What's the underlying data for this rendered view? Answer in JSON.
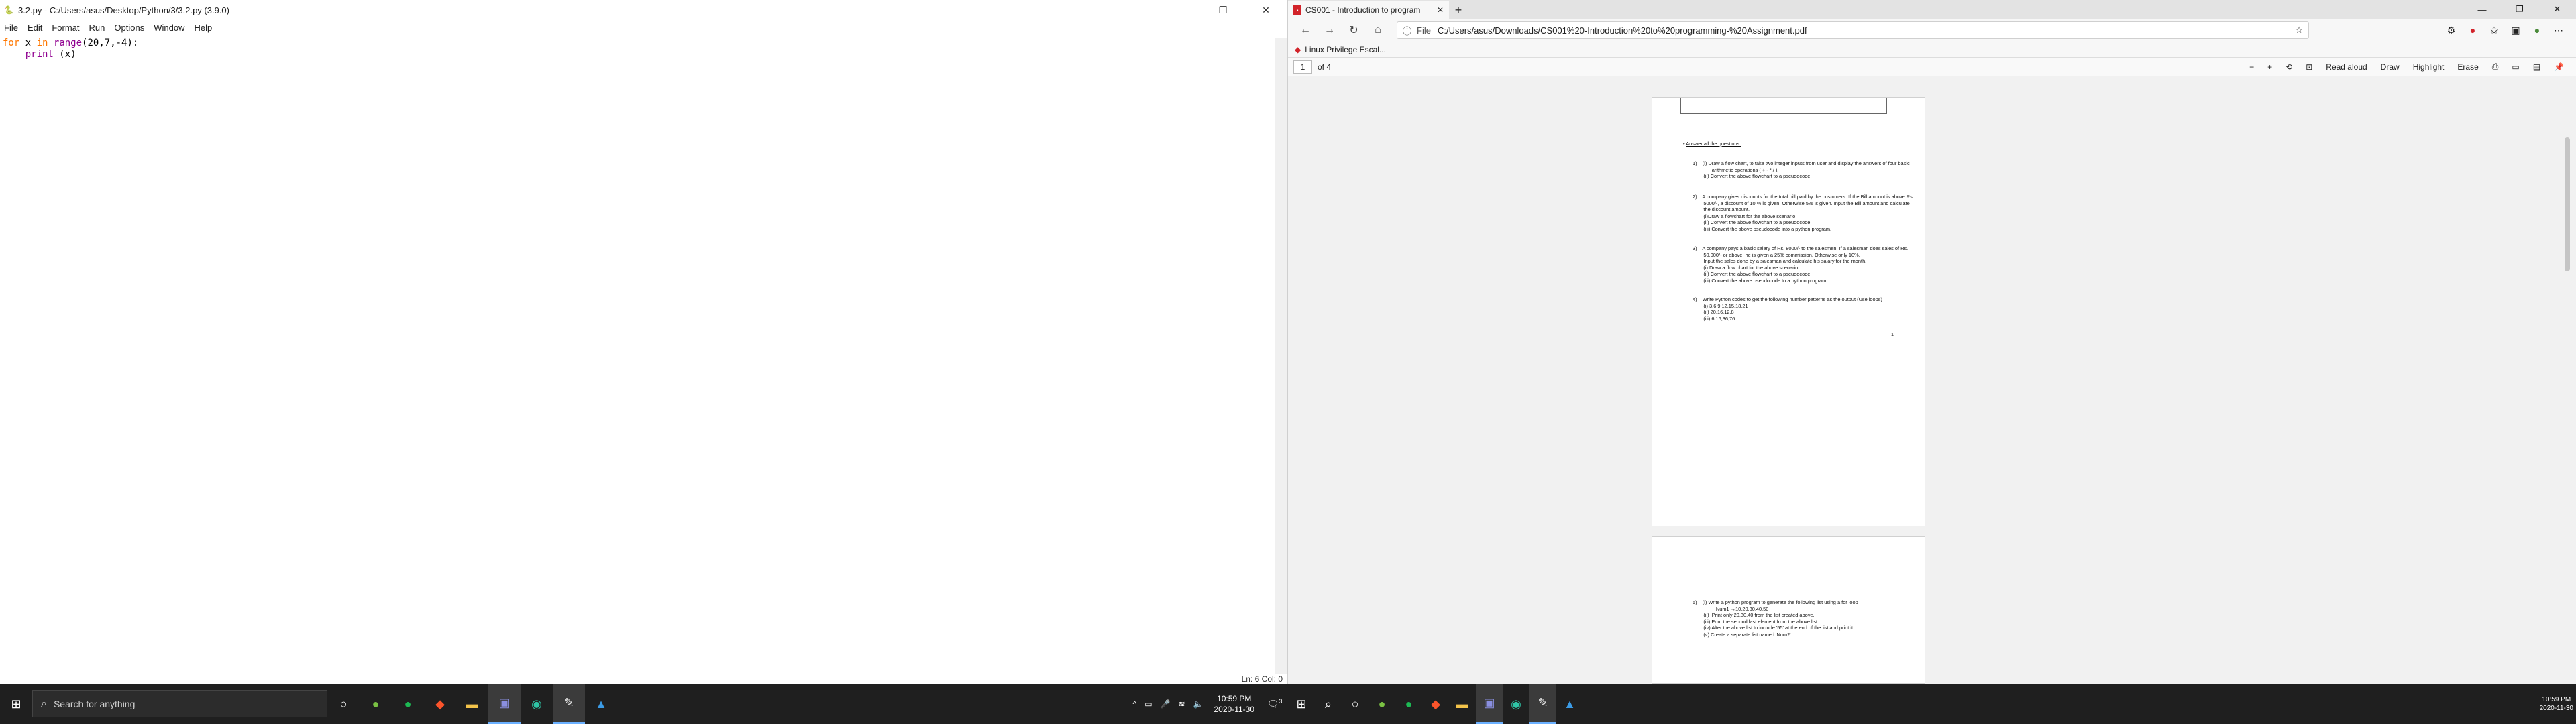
{
  "idle": {
    "title": "3.2.py - C:/Users/asus/Desktop/Python/3/3.2.py (3.9.0)",
    "menu": [
      "File",
      "Edit",
      "Format",
      "Run",
      "Options",
      "Window",
      "Help"
    ],
    "code": {
      "line1_kw1": "for",
      "line1_var": " x ",
      "line1_kw2": "in",
      "line1_sp": " ",
      "line1_builtin": "range",
      "line1_args": "(20,7,-4):",
      "line2_indent": "    ",
      "line2_builtin": "print",
      "line2_args": " (x)"
    },
    "status": "Ln: 6   Col: 0",
    "win_min": "—",
    "win_max": "❐",
    "win_close": "✕"
  },
  "browser": {
    "tab_title": "CS001 - Introduction to program",
    "tab_close": "✕",
    "new_tab": "+",
    "win_min": "—",
    "win_max": "❐",
    "win_close": "✕",
    "address_prefix": "File",
    "address": "C:/Users/asus/Downloads/CS001%20-Introduction%20to%20programming-%20Assignment.pdf",
    "bookmark": "Linux Privilege Escal...",
    "page_current": "1",
    "page_of": "of 4",
    "tools": {
      "zoom_out": "−",
      "zoom_in": "+",
      "read_aloud": "Read aloud",
      "draw": "Draw",
      "highlight": "Highlight",
      "erase": "Erase"
    }
  },
  "pdf": {
    "heading": "Answer all the questions.",
    "q1": [
      "1)    (i) Draw a flow chart, to take two integer inputs from user and display the answers of four basic",
      "              arithmetic operations ( + - * / ).",
      "        (ii) Convert the above flowchart to a pseudocode."
    ],
    "q2": [
      "2)    A company gives discounts for the total bill paid by the customers. If the Bill amount is above Rs.",
      "        5000/-, a discount of 10 % is given. Otherwise 5% is given. Input the Bill amount and calculate",
      "        the discount amount.",
      "        (i)Draw a flowchart for the above scenario",
      "        (ii) Convert the above flowchart to a pseudocode.",
      "        (iii) Convert the above pseudocode into a python program."
    ],
    "q3": [
      "3)    A company pays a basic salary of Rs. 8000/- to the salesmen. If a salesman does sales of Rs.",
      "        50,000/- or above, he is given a 25% commission. Otherwise only 10%.",
      "        Input the sales done by a salesman and calculate his salary for the month.",
      "        (i) Draw a flow chart for the above scenario.",
      "        (ii) Convert the above flowchart to a pseudocode.",
      "        (iii) Convert the above pseudocode to a python program."
    ],
    "q4": [
      "4)    Write Python codes to get the following number patterns as the output (Use loops)",
      "        (i) 3,6,9,12,15,18,21",
      "        (ii) 20,16,12,8",
      "        (iii) 6,16,36,76"
    ],
    "page_number": "1",
    "q5": [
      "5)    (i) Write a python program to generate the following list using a for loop",
      "",
      "                 Num1 →10,20,30,40,50",
      "",
      "        (ii)  Print only 20,30,40 from the list created above.",
      "        (iii) Print the second last element from the above list.",
      "        (iv) Alter the above list to include '55' at the end of the list and print it.",
      "        (v) Create a separate list named 'Num2'."
    ]
  },
  "taskbar": {
    "search_placeholder": "Search for anything",
    "time": "10:59 PM",
    "date": "2020-11-30",
    "right_time": "10:59 PM",
    "right_date": "2020-11-30",
    "notification_count": "3"
  }
}
